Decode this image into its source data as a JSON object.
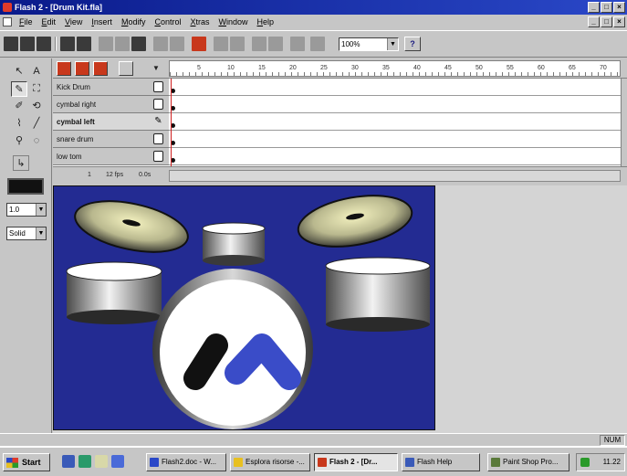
{
  "window": {
    "title": "Flash 2 - [Drum Kit.fla]"
  },
  "menu": [
    "File",
    "Edit",
    "View",
    "Insert",
    "Modify",
    "Control",
    "Xtras",
    "Window",
    "Help"
  ],
  "toolbar": {
    "zoom": "100%"
  },
  "tools": {
    "line_width": "1.0",
    "line_style": "Solid"
  },
  "timeline": {
    "ruler_ticks": [
      "5",
      "10",
      "15",
      "20",
      "25",
      "30",
      "35",
      "40",
      "45",
      "50",
      "55",
      "60",
      "65",
      "70"
    ],
    "layers": [
      {
        "name": "Kick Drum",
        "bold": false
      },
      {
        "name": "cymbal right",
        "bold": false
      },
      {
        "name": "cymbal left",
        "bold": true
      },
      {
        "name": "snare drum",
        "bold": false
      },
      {
        "name": "low tom",
        "bold": false
      }
    ],
    "frame": "1",
    "fps": "12 fps",
    "time": "0.0s"
  },
  "status": {
    "num": "NUM"
  },
  "taskbar": {
    "start": "Start",
    "tasks": [
      "Flash2.doc - W...",
      "Esplora risorse -...",
      "Flash 2 - [Dr...",
      "Flash Help",
      "Paint Shop Pro..."
    ],
    "clock": "11.22"
  },
  "colors": {
    "stage": "#232b92",
    "title": "#0a1a8a",
    "logo_blue": "#3a4cc8"
  }
}
